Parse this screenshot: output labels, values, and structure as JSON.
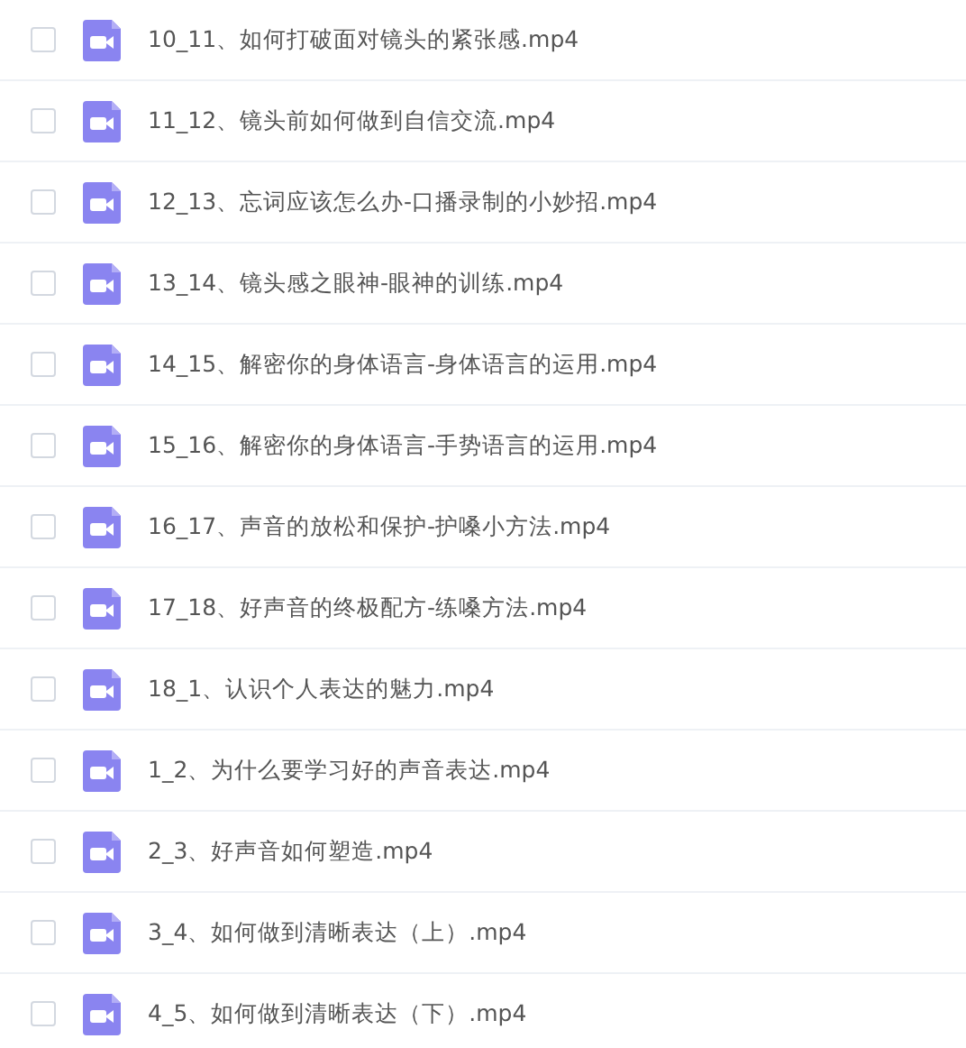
{
  "files": [
    {
      "name": "10_11、如何打破面对镜头的紧张感.mp4",
      "checked": false
    },
    {
      "name": "11_12、镜头前如何做到自信交流.mp4",
      "checked": false
    },
    {
      "name": "12_13、忘词应该怎么办-口播录制的小妙招.mp4",
      "checked": false
    },
    {
      "name": "13_14、镜头感之眼神-眼神的训练.mp4",
      "checked": false
    },
    {
      "name": "14_15、解密你的身体语言-身体语言的运用.mp4",
      "checked": false
    },
    {
      "name": "15_16、解密你的身体语言-手势语言的运用.mp4",
      "checked": false
    },
    {
      "name": "16_17、声音的放松和保护-护嗓小方法.mp4",
      "checked": false
    },
    {
      "name": "17_18、好声音的终极配方-练嗓方法.mp4",
      "checked": false
    },
    {
      "name": "18_1、认识个人表达的魅力.mp4",
      "checked": false
    },
    {
      "name": "1_2、为什么要学习好的声音表达.mp4",
      "checked": false
    },
    {
      "name": "2_3、好声音如何塑造.mp4",
      "checked": false
    },
    {
      "name": "3_4、如何做到清晰表达（上）.mp4",
      "checked": false
    },
    {
      "name": "4_5、如何做到清晰表达（下）.mp4",
      "checked": false
    }
  ]
}
